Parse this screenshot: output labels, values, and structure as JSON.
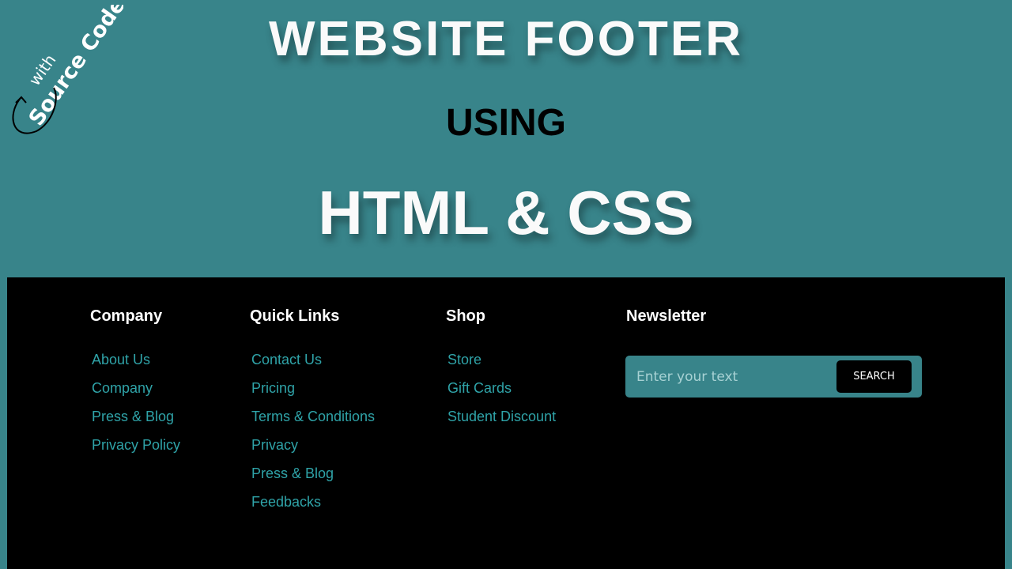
{
  "banner": {
    "corner_small": "with",
    "corner_large": "Source Code",
    "title_line1": "WEBSITE  FOOTER",
    "title_line2": "USING",
    "title_line3": "HTML & CSS"
  },
  "footer": {
    "columns": [
      {
        "heading": "Company",
        "links": [
          "About Us",
          "Company",
          "Press & Blog",
          "Privacy Policy"
        ]
      },
      {
        "heading": "Quick Links",
        "links": [
          "Contact Us",
          "Pricing",
          "Terms & Conditions",
          "Privacy",
          "Press & Blog",
          "Feedbacks"
        ]
      },
      {
        "heading": "Shop",
        "links": [
          "Store",
          "Gift Cards",
          "Student Discount"
        ]
      }
    ],
    "newsletter": {
      "heading": "Newsletter",
      "placeholder": "Enter your text",
      "button_label": "SEARCH"
    }
  },
  "colors": {
    "teal": "#38848a",
    "link": "#2fa3a8",
    "footer_bg": "#000000"
  }
}
